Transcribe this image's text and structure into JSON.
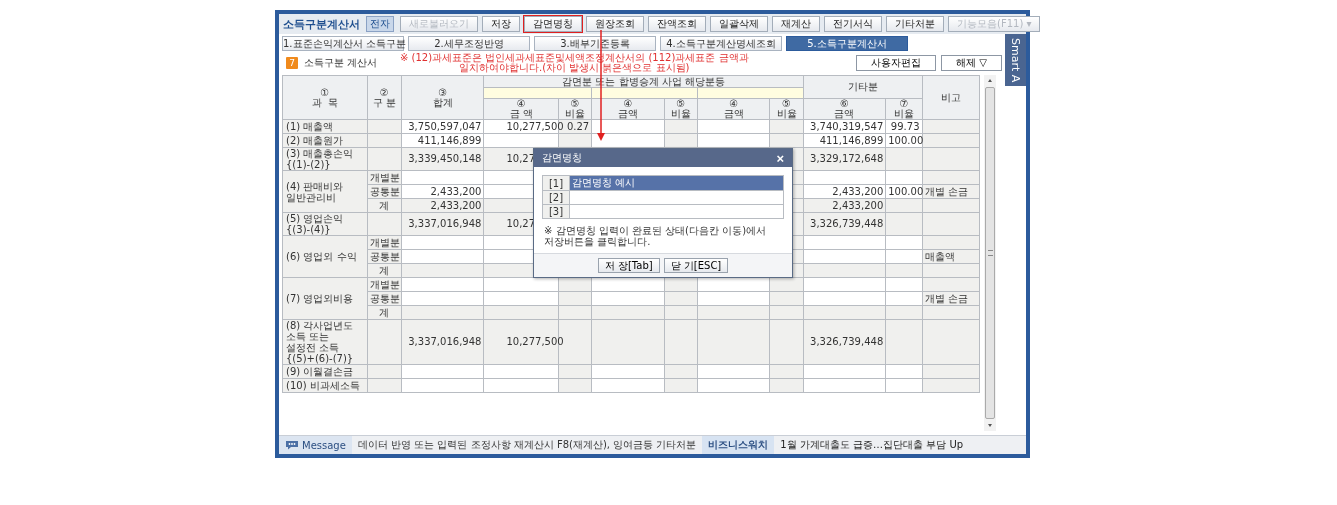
{
  "window": {
    "title": "소득구분계산서",
    "badge": "전자"
  },
  "toolbar": [
    {
      "label": "새로불러오기",
      "disabled": true,
      "highlighted": false
    },
    {
      "label": "저장",
      "disabled": false,
      "highlighted": false
    },
    {
      "label": "감면명칭",
      "disabled": false,
      "highlighted": true
    },
    {
      "label": "원장조회",
      "disabled": false,
      "highlighted": false
    },
    {
      "label": "잔액조회",
      "disabled": false,
      "highlighted": false
    },
    {
      "label": "일괄삭제",
      "disabled": false,
      "highlighted": false
    },
    {
      "label": "재계산",
      "disabled": false,
      "highlighted": false
    },
    {
      "label": "전기서식",
      "disabled": false,
      "highlighted": false
    },
    {
      "label": "기타처분",
      "disabled": false,
      "highlighted": false
    },
    {
      "label": "기능모음(F11) ▾",
      "disabled": true,
      "highlighted": false
    }
  ],
  "tabs": [
    {
      "label": "1.표준손익계산서 소득구분",
      "selected": false
    },
    {
      "label": "2.세무조정반영",
      "selected": false
    },
    {
      "label": "3.배부기준등록",
      "selected": false
    },
    {
      "label": "4.소득구분계산명세조회",
      "selected": false
    },
    {
      "label": "5.소득구분계산서",
      "selected": true
    }
  ],
  "side_tab": "Smart A",
  "section": {
    "icon": "7",
    "title": "소득구분 계산서",
    "notice": "※ (12)과세표준은 법인세과세표준및세액조정계산서의 (112)과세표준 금액과\n일치하여야합니다.(차이 발생시 붉은색으로 표시됨)",
    "buttons": [
      "사용자편집",
      "해제 ▽"
    ]
  },
  "table": {
    "header": {
      "subject": "①\n과  목",
      "part": "②\n구 분",
      "total": "③\n합계",
      "group": "감면분 또는 합병승계 사업 해당분등",
      "other_group": "기타분",
      "note": "비고",
      "columns": [
        "④\n금 액",
        "⑤\n비율",
        "④\n금액",
        "⑤\n비율",
        "④\n금액",
        "⑤\n비율",
        "⑥\n금액",
        "⑦\n비율"
      ]
    },
    "rows": [
      {
        "label": "(1) 매출액",
        "shaded": false,
        "lines": [
          {
            "total": "3,750,597,047",
            "amount_1": "10,277,500",
            "ratio_1": "0.27",
            "amount_other": "3,740,319,547",
            "ratio_other": "99.73"
          }
        ]
      },
      {
        "label": "(2) 매출원가",
        "shaded": false,
        "lines": [
          {
            "total": "411,146,899",
            "amount_other": "411,146,899",
            "ratio_other": "100.00"
          }
        ]
      },
      {
        "label": "(3) 매출총손익\n{(1)-(2)}",
        "shaded": true,
        "lines": [
          {
            "total": "3,339,450,148",
            "amount_1": "10,27",
            "amount_other": "3,329,172,648"
          }
        ]
      },
      {
        "label": "(4) 판매비와\n일반관리비",
        "shaded": false,
        "lines": [
          {
            "part": "개별분"
          },
          {
            "part": "공통분",
            "total": "2,433,200",
            "amount_other": "2,433,200",
            "ratio_other": "100.00",
            "note": "개별 손금"
          },
          {
            "part": "계",
            "total": "2,433,200",
            "amount_other": "2,433,200"
          }
        ]
      },
      {
        "label": "(5) 영업손익\n{(3)-(4)}",
        "shaded": true,
        "lines": [
          {
            "total": "3,337,016,948",
            "amount_1": "10,27",
            "amount_other": "3,326,739,448"
          }
        ]
      },
      {
        "label": "(6) 영업외 수익",
        "shaded": false,
        "lines": [
          {
            "part": "개별분"
          },
          {
            "part": "공통분",
            "note": "매출액"
          },
          {
            "part": "계"
          }
        ]
      },
      {
        "label": "(7) 영업외비용",
        "shaded": false,
        "lines": [
          {
            "part": "개별분"
          },
          {
            "part": "공통분",
            "note": "개별 손금"
          },
          {
            "part": "계"
          }
        ]
      },
      {
        "label": "(8) 각사업년도\n소득 또는\n설정전 소득\n{(5)+(6)-(7)}",
        "shaded": true,
        "lines": [
          {
            "total": "3,337,016,948",
            "amount_1": "10,277,500",
            "amount_other": "3,326,739,448"
          }
        ]
      },
      {
        "label": "(9) 이월결손금",
        "shaded": false
      },
      {
        "label": "(10) 비과세소득",
        "shaded": false
      }
    ]
  },
  "dialog": {
    "title": "감면명칭",
    "close": "×",
    "rows": [
      {
        "no": "[1]",
        "value": "감면명칭 예시",
        "selected": true
      },
      {
        "no": "[2]",
        "selected": false
      },
      {
        "no": "[3]",
        "selected": false
      }
    ],
    "note": "※ 감면명칭 입력이 완료된 상태(다음칸 이동)에서\n저장버튼을 클릭합니다.",
    "buttons": [
      "저 장[Tab]",
      "닫 기[ESC]"
    ]
  },
  "status_bar": {
    "label": "Message",
    "text": "데이터 반영 또는 입력된 조정사항 재계산시 F8(재계산), 잉여금등 기타처분",
    "source": "비즈니스워치",
    "headline": "1월 가계대출도 급증…집단대출 부담 Up"
  }
}
